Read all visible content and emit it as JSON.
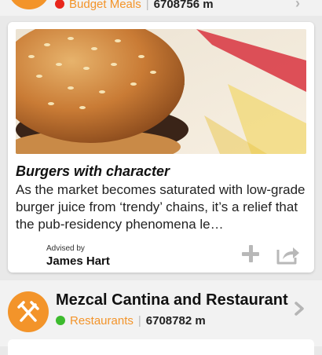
{
  "previous_item": {
    "category": "Budget Meals",
    "distance": "6708756 m"
  },
  "article": {
    "image_icon": "burger-photo",
    "title": "Burgers with character",
    "excerpt": "As the market becomes saturated with low-grade burger juice from ‘trendy’ chains, it’s a relief that the pub-residency phenomena le…",
    "advised_label": "Advised by",
    "advisor": "James Hart",
    "add_icon": "plus-icon",
    "share_icon": "share-icon"
  },
  "venue": {
    "name": "Mezcal Cantina and Restaurant",
    "category": "Restaurants",
    "distance": "6708782 m",
    "avatar_icon": "fork-knife-icon",
    "status_color": "#3dbb2e"
  },
  "colors": {
    "accent": "#f3942a",
    "closed_dot": "#e8261c",
    "open_dot": "#3dbb2e"
  }
}
